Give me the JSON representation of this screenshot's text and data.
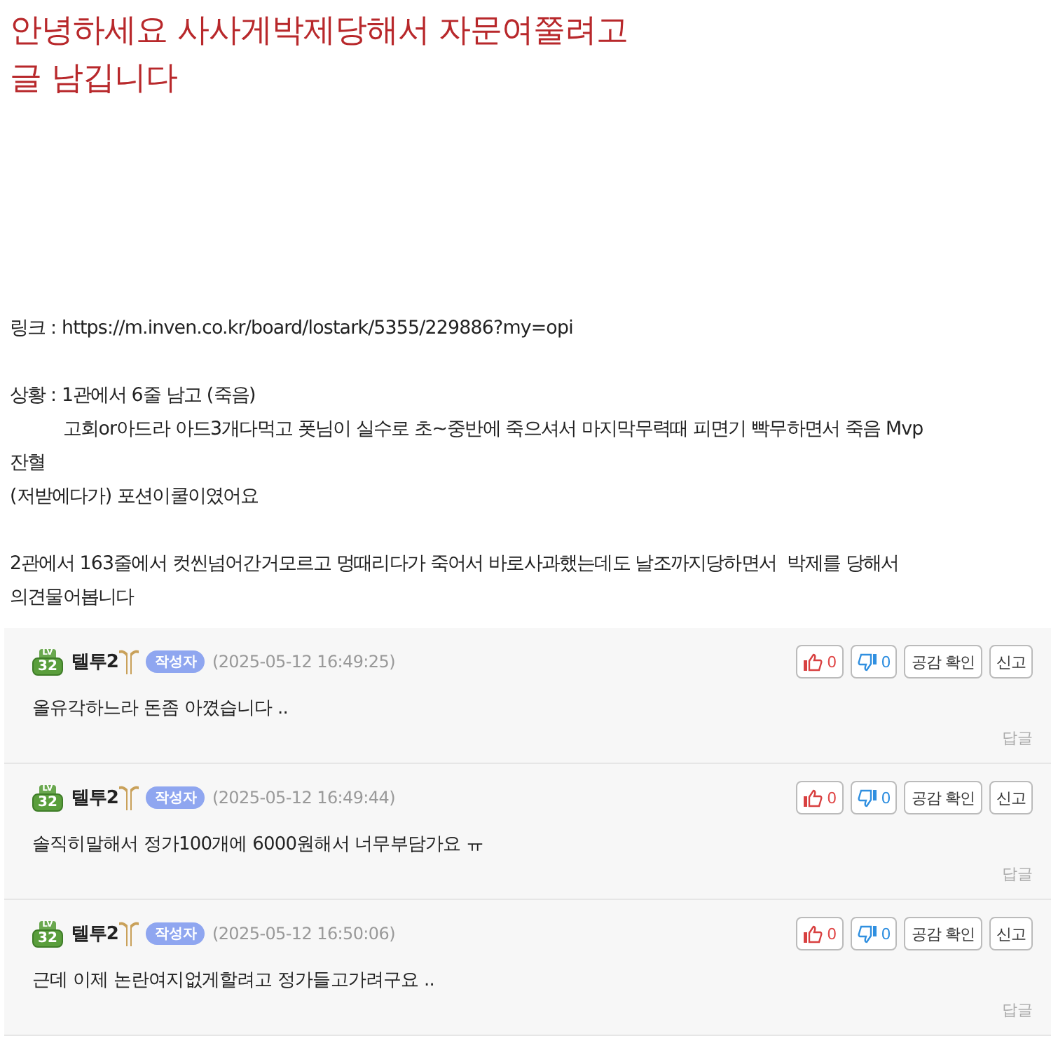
{
  "title": "안녕하세요 사사게박제당해서 자문여쭐려고\n글 남깁니다",
  "body": [
    {
      "kind": "line",
      "text": "링크 : https://m.inven.co.kr/board/lostark/5355/229886?my=opi"
    },
    {
      "kind": "blank"
    },
    {
      "kind": "line",
      "text": "상황 : 1관에서 6줄 남고 (죽음)"
    },
    {
      "kind": "indent",
      "text": "고회or아드라 아드3개다먹고 폿님이 실수로 초~중반에 죽으셔서 마지막무력때 피면기 빡무하면서 죽음 Mvp"
    },
    {
      "kind": "line",
      "text": "잔혈"
    },
    {
      "kind": "line",
      "text": "(저받에다가) 포션이쿨이였어요"
    },
    {
      "kind": "blank"
    },
    {
      "kind": "line",
      "text": "2관에서 163줄에서 컷씬넘어간거모르고 멍때리다가 죽어서 바로사과했는데도 날조까지당하면서  박제를 당해서"
    },
    {
      "kind": "line",
      "text": "의견물어봅니다"
    }
  ],
  "comments": [
    {
      "level_label": "LV",
      "level": "32",
      "author": "텔투2",
      "tag": "작성자",
      "time": "(2025-05-12 16:49:25)",
      "likes": "0",
      "dislikes": "0",
      "check": "공감 확인",
      "report": "신고",
      "text": "올유각하느라 돈좀 아꼈습니다 ..",
      "reply": "답글"
    },
    {
      "level_label": "LV",
      "level": "32",
      "author": "텔투2",
      "tag": "작성자",
      "time": "(2025-05-12 16:49:44)",
      "likes": "0",
      "dislikes": "0",
      "check": "공감 확인",
      "report": "신고",
      "text": "솔직히말해서 정가100개에 6000원해서 너무부담가요 ㅠ",
      "reply": "답글"
    },
    {
      "level_label": "LV",
      "level": "32",
      "author": "텔투2",
      "tag": "작성자",
      "time": "(2025-05-12 16:50:06)",
      "likes": "0",
      "dislikes": "0",
      "check": "공감 확인",
      "report": "신고",
      "text": "근데 이제 논란여지없게할려고 정가들고가려구요 ..",
      "reply": "답글"
    }
  ]
}
